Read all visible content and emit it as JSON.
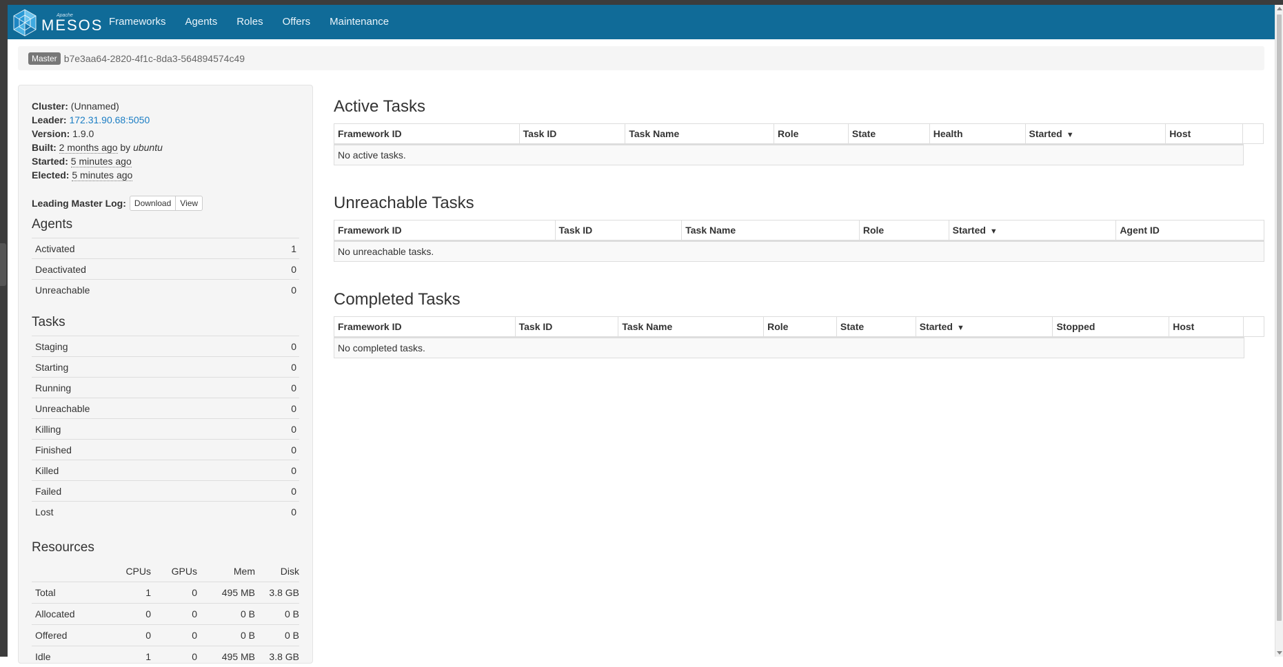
{
  "nav": {
    "brand_apache": "Apache",
    "brand_name": "MESOS",
    "items": [
      {
        "label": "Frameworks"
      },
      {
        "label": "Agents"
      },
      {
        "label": "Roles"
      },
      {
        "label": "Offers"
      },
      {
        "label": "Maintenance"
      }
    ]
  },
  "breadcrumb": {
    "badge": "Master",
    "master_id": "b7e3aa64-2820-4f1c-8da3-564894574c49"
  },
  "cluster": {
    "cluster_label": "Cluster:",
    "cluster_value": "(Unnamed)",
    "leader_label": "Leader:",
    "leader_value": "172.31.90.68:5050",
    "version_label": "Version:",
    "version_value": "1.9.0",
    "built_label": "Built:",
    "built_when": "2 months ago",
    "built_by_text": "by",
    "built_by": "ubuntu",
    "started_label": "Started:",
    "started_value": "5 minutes ago",
    "elected_label": "Elected:",
    "elected_value": "5 minutes ago",
    "log_label": "Leading Master Log:",
    "download_label": "Download",
    "view_label": "View"
  },
  "agents": {
    "title": "Agents",
    "rows": [
      {
        "label": "Activated",
        "value": "1"
      },
      {
        "label": "Deactivated",
        "value": "0"
      },
      {
        "label": "Unreachable",
        "value": "0"
      }
    ]
  },
  "tasks": {
    "title": "Tasks",
    "rows": [
      {
        "label": "Staging",
        "value": "0"
      },
      {
        "label": "Starting",
        "value": "0"
      },
      {
        "label": "Running",
        "value": "0"
      },
      {
        "label": "Unreachable",
        "value": "0"
      },
      {
        "label": "Killing",
        "value": "0"
      },
      {
        "label": "Finished",
        "value": "0"
      },
      {
        "label": "Killed",
        "value": "0"
      },
      {
        "label": "Failed",
        "value": "0"
      },
      {
        "label": "Lost",
        "value": "0"
      }
    ]
  },
  "resources": {
    "title": "Resources",
    "headers": [
      "",
      "CPUs",
      "GPUs",
      "Mem",
      "Disk"
    ],
    "rows": [
      {
        "label": "Total",
        "cpus": "1",
        "gpus": "0",
        "mem": "495 MB",
        "disk": "3.8 GB"
      },
      {
        "label": "Allocated",
        "cpus": "0",
        "gpus": "0",
        "mem": "0 B",
        "disk": "0 B"
      },
      {
        "label": "Offered",
        "cpus": "0",
        "gpus": "0",
        "mem": "0 B",
        "disk": "0 B"
      },
      {
        "label": "Idle",
        "cpus": "1",
        "gpus": "0",
        "mem": "495 MB",
        "disk": "3.8 GB"
      }
    ]
  },
  "active_tasks": {
    "title": "Active Tasks",
    "columns": [
      "Framework ID",
      "Task ID",
      "Task Name",
      "Role",
      "State",
      "Health",
      "Started",
      "Host",
      ""
    ],
    "empty": "No active tasks."
  },
  "unreachable_tasks": {
    "title": "Unreachable Tasks",
    "columns": [
      "Framework ID",
      "Task ID",
      "Task Name",
      "Role",
      "Started",
      "Agent ID"
    ],
    "empty": "No unreachable tasks."
  },
  "completed_tasks": {
    "title": "Completed Tasks",
    "columns": [
      "Framework ID",
      "Task ID",
      "Task Name",
      "Role",
      "State",
      "Started",
      "Stopped",
      "Host",
      ""
    ],
    "empty": "No completed tasks."
  },
  "sort_caret": "▼",
  "colors": {
    "navbar": "#106b98",
    "link": "#1a7dc4"
  }
}
